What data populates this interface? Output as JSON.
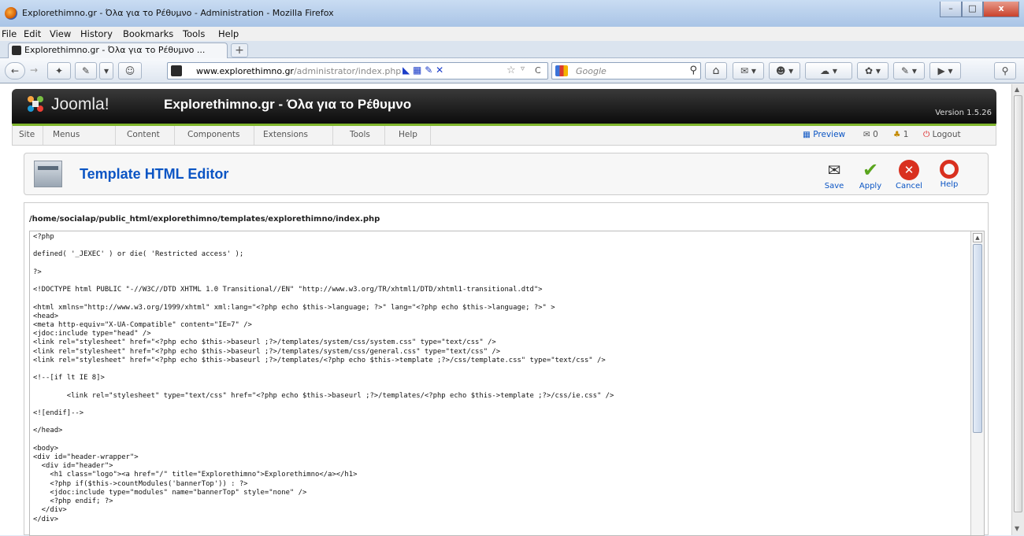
{
  "window": {
    "title": "Explorethimno.gr - Όλα για το Ρέθυμνο - Administration - Mozilla Firefox",
    "min_label": "–",
    "max_label": "□",
    "close_label": "x"
  },
  "menubar": [
    "File",
    "Edit",
    "View",
    "History",
    "Bookmarks",
    "Tools",
    "Help"
  ],
  "tabs": [
    {
      "label": "Explorethimno.gr - Όλα για το Ρέθυμνο ..."
    }
  ],
  "newtab_label": "+",
  "nav": {
    "url_host": "www.explorethimno.gr",
    "url_path": "/administrator/index.php",
    "search_placeholder": "Google",
    "back": "←",
    "forward": "→",
    "reload": "C",
    "star": "☆",
    "home": "⌂"
  },
  "joomla": {
    "logo_text": "Joomla!",
    "site_title": "Explorethimno.gr - Όλα για το Ρέθυμνο",
    "version": "Version 1.5.26",
    "menu": [
      "Site",
      "Menus",
      "Content",
      "Components",
      "Extensions",
      "Tools",
      "Help"
    ],
    "status": {
      "preview": "Preview",
      "messages": "0",
      "users": "1",
      "logout": "Logout"
    }
  },
  "toolbar": {
    "title": "Template HTML Editor",
    "buttons": [
      {
        "label": "Save"
      },
      {
        "label": "Apply"
      },
      {
        "label": "Cancel"
      },
      {
        "label": "Help"
      }
    ]
  },
  "editor": {
    "path": "/home/socialap/public_html/explorethimno/templates/explorethimno/index.php",
    "code": "<?php\n\ndefined( '_JEXEC' ) or die( 'Restricted access' );\n\n?>\n\n<!DOCTYPE html PUBLIC \"-//W3C//DTD XHTML 1.0 Transitional//EN\" \"http://www.w3.org/TR/xhtml1/DTD/xhtml1-transitional.dtd\">\n\n<html xmlns=\"http://www.w3.org/1999/xhtml\" xml:lang=\"<?php echo $this->language; ?>\" lang=\"<?php echo $this->language; ?>\" >\n<head>\n<meta http-equiv=\"X-UA-Compatible\" content=\"IE=7\" />\n<jdoc:include type=\"head\" />\n<link rel=\"stylesheet\" href=\"<?php echo $this->baseurl ;?>/templates/system/css/system.css\" type=\"text/css\" />\n<link rel=\"stylesheet\" href=\"<?php echo $this->baseurl ;?>/templates/system/css/general.css\" type=\"text/css\" />\n<link rel=\"stylesheet\" href=\"<?php echo $this->baseurl ;?>/templates/<?php echo $this->template ;?>/css/template.css\" type=\"text/css\" />\n\n<!--[if lt IE 8]>\n\n        <link rel=\"stylesheet\" type=\"text/css\" href=\"<?php echo $this->baseurl ;?>/templates/<?php echo $this->template ;?>/css/ie.css\" />\n\n<![endif]-->\n\n</head>\n\n<body>\n<div id=\"header-wrapper\">\n  <div id=\"header\">\n    <h1 class=\"logo\"><a href=\"/\" title=\"Explorethimno\">Explorethimno</a></h1>\n    <?php if($this->countModules('bannerTop')) : ?>\n    <jdoc:include type=\"modules\" name=\"bannerTop\" style=\"none\" />\n    <?php endif; ?>\n  </div>\n</div>"
  }
}
